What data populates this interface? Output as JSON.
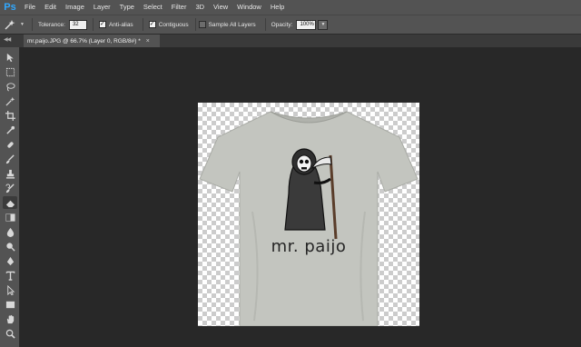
{
  "app": {
    "logo": "Ps"
  },
  "menu": [
    "File",
    "Edit",
    "Image",
    "Layer",
    "Type",
    "Select",
    "Filter",
    "3D",
    "View",
    "Window",
    "Help"
  ],
  "options": {
    "tool_icon": "magic-wand-icon",
    "tolerance_label": "Tolerance:",
    "tolerance_value": "32",
    "anti_alias_label": "Anti-alias",
    "anti_alias_checked": true,
    "contiguous_label": "Contiguous",
    "contiguous_checked": true,
    "sample_all_label": "Sample All Layers",
    "sample_all_checked": false,
    "opacity_label": "Opacity:",
    "opacity_value": "100%"
  },
  "document_tab": {
    "title": "mr.paijo.JPG @ 66.7% (Layer 0, RGB/8#) *",
    "close": "×"
  },
  "canvas": {
    "shirt_text": "mr. paijo",
    "shirt_color": "#c3c5bf",
    "transparency_grid": true
  },
  "tools": [
    "move-tool-icon",
    "marquee-tool-icon",
    "lasso-tool-icon",
    "magic-wand-tool-icon",
    "crop-tool-icon",
    "eyedropper-tool-icon",
    "healing-brush-tool-icon",
    "brush-tool-icon",
    "clone-stamp-tool-icon",
    "history-brush-tool-icon",
    "eraser-tool-icon",
    "gradient-tool-icon",
    "blur-tool-icon",
    "dodge-tool-icon",
    "pen-tool-icon",
    "type-tool-icon",
    "path-selection-tool-icon",
    "rectangle-tool-icon",
    "hand-tool-icon",
    "zoom-tool-icon"
  ]
}
